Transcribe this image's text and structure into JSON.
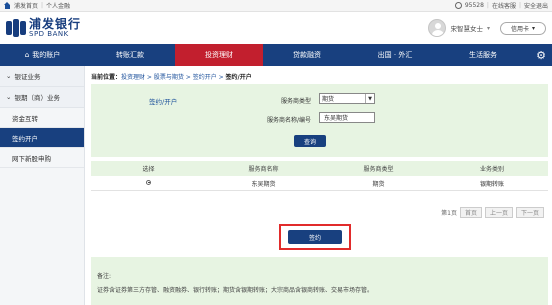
{
  "topbar": {
    "home": "浦发首页",
    "personal": "个人金融",
    "phone": "95528",
    "online_service": "在线客服",
    "logout": "安全退出"
  },
  "brand": {
    "name_cn": "浦发银行",
    "name_en": "SPD BANK",
    "user_name": "宋智慧女士",
    "card_label": "信用卡"
  },
  "nav": {
    "items": [
      {
        "label": "我的账户",
        "icon": "home-icon"
      },
      {
        "label": "转账汇款"
      },
      {
        "label": "投资理财",
        "active": true
      },
      {
        "label": "贷款融资"
      },
      {
        "label": "出国 · 外汇"
      },
      {
        "label": "生活服务"
      }
    ]
  },
  "sidebar": {
    "groups": [
      {
        "label": "银证业务"
      },
      {
        "label": "银期（商）业务"
      }
    ],
    "items": [
      {
        "label": "资金互转"
      },
      {
        "label": "签约开户",
        "active": true
      },
      {
        "label": "网下新股申购"
      }
    ]
  },
  "breadcrumb": {
    "prefix": "当前位置：",
    "path": "投资理财 > 股票与期货 > 签约开户 > ",
    "current": "签约/开户"
  },
  "form": {
    "title": "签约/开户",
    "type_label": "服务商类型",
    "type_value": "期货",
    "name_label": "服务商名称/编号",
    "name_value": "东吴期货",
    "query_button": "查询"
  },
  "table": {
    "headers": [
      "选择",
      "服务商名称",
      "服务商类型",
      "业务类别"
    ],
    "rows": [
      {
        "name": "东吴期货",
        "type": "期货",
        "category": "银期转账"
      }
    ]
  },
  "pager": {
    "page_info": "第1页",
    "first": "首页",
    "prev": "上一页",
    "next": "下一页"
  },
  "sign_button": "签约",
  "notes": {
    "title": "备注:",
    "body": "证券含证券第三方存管、融资融券、银行转账；期货含银期转账；大宗商品含银商转账、交易市场存管。"
  },
  "colors": {
    "nav_bg": "#18407f",
    "nav_active": "#c21f2e",
    "panel_green": "#e7f4e2",
    "highlight_red": "#e12b2b"
  }
}
